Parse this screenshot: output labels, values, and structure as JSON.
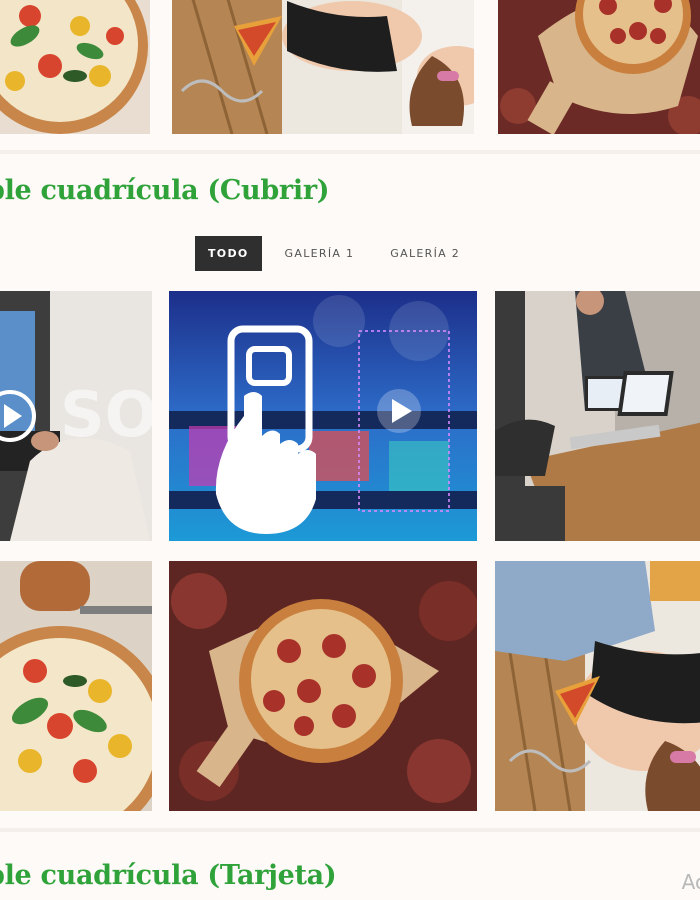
{
  "headings": {
    "grid_cover": "ble cuadrícula (Cubrir)",
    "grid_card": "ble cuadrícula (Tarjeta)"
  },
  "filters": [
    {
      "label": "TODO",
      "active": true
    },
    {
      "label": "GALERÍA 1",
      "active": false
    },
    {
      "label": "GALERÍA 2",
      "active": false
    }
  ],
  "top_row": [
    "pizza-margherita-photo",
    "woman-eating-pizza-photo",
    "pepperoni-pizza-photo"
  ],
  "gallery": [
    {
      "name": "laptop-video-thumbnail",
      "has_play": true
    },
    {
      "name": "social-media-video-thumbnail",
      "has_play": true
    },
    {
      "name": "office-meeting-photo",
      "has_play": false
    },
    {
      "name": "pizza-margherita-photo",
      "has_play": false
    },
    {
      "name": "pepperoni-pizza-photo",
      "has_play": false
    },
    {
      "name": "woman-eating-pizza-photo",
      "has_play": false
    }
  ],
  "watermark": "Ac",
  "colors": {
    "heading_green": "#2fa33a",
    "active_tab_bg": "#2f2f2f",
    "page_bg": "#fdfaf7"
  }
}
